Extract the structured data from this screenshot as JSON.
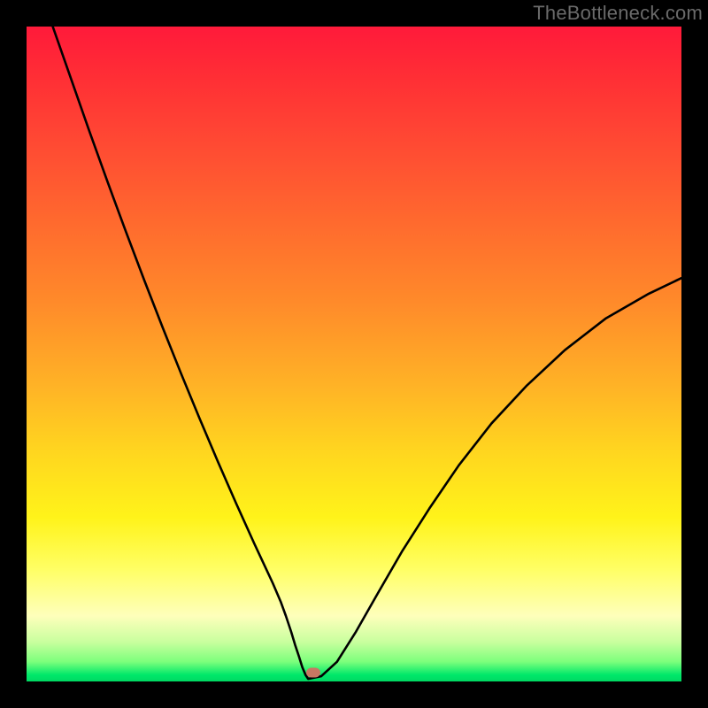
{
  "watermark": "TheBottleneck.com",
  "chart_data": {
    "type": "line",
    "title": "",
    "xlabel": "",
    "ylabel": "",
    "xlim": [
      0,
      100
    ],
    "ylim": [
      0,
      100
    ],
    "grid": false,
    "legend": false,
    "curve_x": [
      4.0,
      6.8,
      9.6,
      12.4,
      15.2,
      18.0,
      20.8,
      23.6,
      26.4,
      29.2,
      32.0,
      34.8,
      37.6,
      38.8,
      39.6,
      40.4,
      41.0,
      41.6,
      42.1,
      42.6,
      43.0,
      45.0,
      47.4,
      50.3,
      53.6,
      57.3,
      61.5,
      66.0,
      71.0,
      76.4,
      82.2,
      88.4,
      95.0,
      100.0
    ],
    "curve_y": [
      100.0,
      92.0,
      84.0,
      76.2,
      68.6,
      61.2,
      54.0,
      47.0,
      40.2,
      33.6,
      27.2,
      21.0,
      15.0,
      12.2,
      10.0,
      7.6,
      5.6,
      3.8,
      2.2,
      1.0,
      0.4,
      0.8,
      3.0,
      7.6,
      13.4,
      19.8,
      26.4,
      33.0,
      39.4,
      45.2,
      50.6,
      55.4,
      59.2,
      61.6
    ],
    "marker": {
      "x": 43.8,
      "y": 1.4
    },
    "background_gradient_stops": [
      {
        "pos": 0.0,
        "color": "#ff1a3a"
      },
      {
        "pos": 0.3,
        "color": "#ff6a2e"
      },
      {
        "pos": 0.55,
        "color": "#ffb326"
      },
      {
        "pos": 0.75,
        "color": "#fff31a"
      },
      {
        "pos": 0.9,
        "color": "#feffbb"
      },
      {
        "pos": 0.97,
        "color": "#7cff7c"
      },
      {
        "pos": 1.0,
        "color": "#00d862"
      }
    ]
  },
  "colors": {
    "frame": "#000000",
    "curve": "#000000",
    "marker": "#c97763",
    "watermark": "#6a6a6a"
  }
}
